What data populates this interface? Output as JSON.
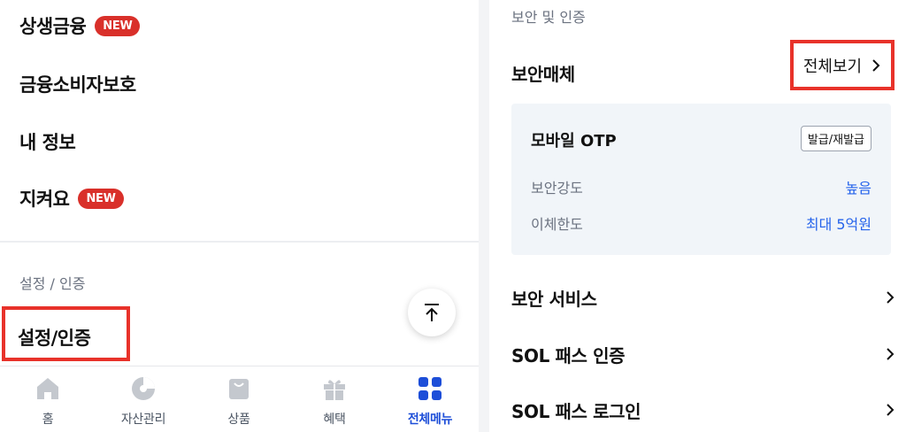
{
  "left_menu": {
    "items": [
      {
        "label": "상생금융",
        "badge": "NEW"
      },
      {
        "label": "금융소비자보호"
      },
      {
        "label": "내 정보"
      },
      {
        "label": "지켜요",
        "badge": "NEW"
      }
    ],
    "section_label": "설정 / 인증",
    "highlighted_item": "설정/인증"
  },
  "tabbar": {
    "tabs": [
      {
        "label": "홈",
        "icon": "home-icon"
      },
      {
        "label": "자산관리",
        "icon": "pie-chart-icon"
      },
      {
        "label": "상품",
        "icon": "bag-icon"
      },
      {
        "label": "혜택",
        "icon": "gift-icon"
      },
      {
        "label": "전체메뉴",
        "icon": "grid-icon",
        "active": true
      }
    ]
  },
  "right_panel": {
    "section_label": "보안 및 인증",
    "security_media": {
      "title": "보안매체",
      "view_all": "전체보기",
      "device": {
        "name": "모바일 OTP",
        "issue_button": "발급/재발급",
        "strength_label": "보안강도",
        "strength_value": "높음",
        "limit_label": "이체한도",
        "limit_value": "최대 5억원"
      }
    },
    "rows": [
      {
        "label": "보안 서비스"
      },
      {
        "label": "SOL 패스 인증"
      },
      {
        "label": "SOL 패스 로그인"
      }
    ]
  },
  "colors": {
    "accent": "#2563eb",
    "active_tab": "#1d4ed8",
    "badge": "#d9302a",
    "highlight_box": "#e8322a",
    "card_bg": "#f1f5f9"
  }
}
